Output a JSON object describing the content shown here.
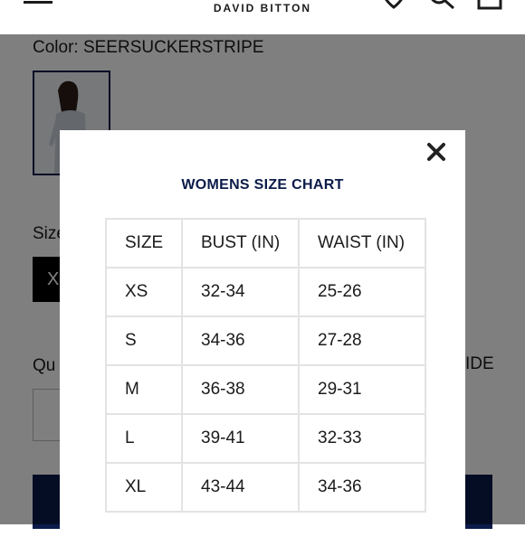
{
  "header": {
    "brand": "DAVID BITTON",
    "icons": [
      "menu-icon",
      "heart-icon",
      "search-icon",
      "bag-icon"
    ]
  },
  "product": {
    "color_label": "Color: SEERSUCKERSTRIPE",
    "size_label": "Size",
    "selected_size": "X",
    "quantity_label": "Qu",
    "size_guide_link": "IDE"
  },
  "modal": {
    "title": "WOMENS SIZE CHART",
    "close_glyph": "×",
    "table": {
      "headers": [
        "SIZE",
        "BUST (IN)",
        "WAIST (IN)"
      ],
      "rows": [
        [
          "XS",
          "32-34",
          "25-26"
        ],
        [
          "S",
          "34-36",
          "27-28"
        ],
        [
          "M",
          "36-38",
          "29-31"
        ],
        [
          "L",
          "39-41",
          "32-33"
        ],
        [
          "XL",
          "43-44",
          "34-36"
        ]
      ]
    }
  },
  "colors": {
    "navy": "#0b1b4a",
    "overlay": "rgba(0,0,0,0.5)",
    "table_border": "#e3e3e3"
  }
}
